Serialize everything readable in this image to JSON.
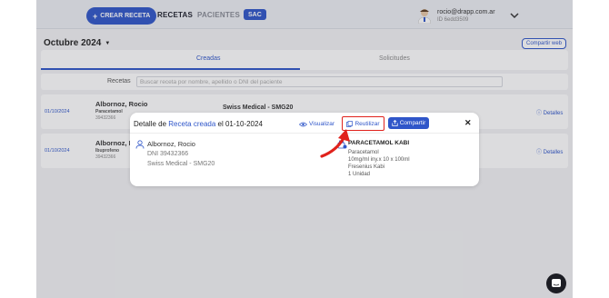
{
  "header": {
    "new_button": "CREAR RECETA",
    "nav": [
      "RECETAS",
      "PACIENTES",
      "SAC"
    ],
    "user_email": "rocio@drapp.com.ar",
    "user_id": "ID 6edd3509"
  },
  "page": {
    "month": "Octubre 2024",
    "share_web": "Compartir web",
    "tabs": [
      "Creadas",
      "Solicitudes"
    ],
    "search_label": "Recetas",
    "search_placeholder": "Buscar receta por nombre, apellido o DNI del paciente"
  },
  "rows": [
    {
      "date": "01/10/2024",
      "name": "Albornoz, Rocio",
      "med": "Paracetamol",
      "dni": "39432366",
      "plan": "Swiss Medical - SMG20",
      "details": "Detalles"
    },
    {
      "date": "01/10/2024",
      "name": "Albornoz, Ro",
      "med": "Ibuprofeno",
      "dni": "39432366",
      "plan": "",
      "details": "Detalles"
    }
  ],
  "modal": {
    "title_prefix": "Detalle de",
    "title_accent": "Receta creada",
    "title_suffix": "el 01-10-2024",
    "view_label": "Visualizar",
    "reuse_label": "Reutilizar",
    "share_label": "Compartir",
    "close_label": "✕",
    "patient": {
      "name": "Albornoz, Rocio",
      "dni": "DNI 39432366",
      "plan": "Swiss Medical - SMG20"
    },
    "drug": {
      "name": "PARACETAMOL KABI",
      "generic": "Paracetamol",
      "presentation": "10mg/ml iny.x 10 x 100ml",
      "lab": "Fresenius Kabi",
      "qty": "1 Unidad"
    }
  },
  "colors": {
    "accent": "#2f56c9",
    "highlight": "#e0221c"
  }
}
